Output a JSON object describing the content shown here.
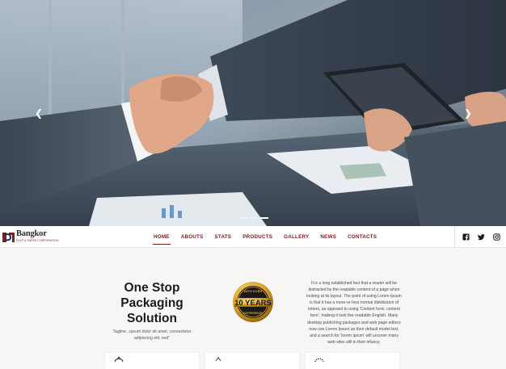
{
  "hero": {
    "prev_icon": "chevron-left-icon",
    "next_icon": "chevron-right-icon",
    "slide_count": 3,
    "active_slide": 2
  },
  "brand": {
    "name": "Bangkor",
    "subtitle": "PULP & PAPER CORPORATION",
    "accent_color": "#7a2120"
  },
  "nav": {
    "items": [
      {
        "label": "HOME",
        "active": true
      },
      {
        "label": "ABOUTS",
        "active": false
      },
      {
        "label": "STATS",
        "active": false
      },
      {
        "label": "PRODUCTS",
        "active": false
      },
      {
        "label": "GALLERY",
        "active": false
      },
      {
        "label": "NEWS",
        "active": false
      },
      {
        "label": "CONTACTS",
        "active": false
      }
    ]
  },
  "social": {
    "icons": [
      "facebook-icon",
      "twitter-icon",
      "instagram-icon"
    ]
  },
  "intro": {
    "headline_1": "One Stop",
    "headline_2": "Packaging",
    "headline_3": "Solution",
    "tagline": "Tagline...ipsum dolor sit amet, consectetur adipiscing elit, sed\"",
    "badge_top": "WITH OVER",
    "badge_main": "10 YEARS",
    "badge_bottom": "EXPERIENCE",
    "paragraph": "It is a long established fact that a reader will be distracted by the readable content of a page when looking at its layout. The point of using Lorem Ipsum is that it has a more-or-less normal distribution of letters, as opposed to using 'Content here, content here', making it look like readable English. Many desktop publishing packages and web page editors now use Lorem Ipsum as their default model text, and a search for 'lorem ipsum' will uncover many web sites still in their infancy."
  }
}
